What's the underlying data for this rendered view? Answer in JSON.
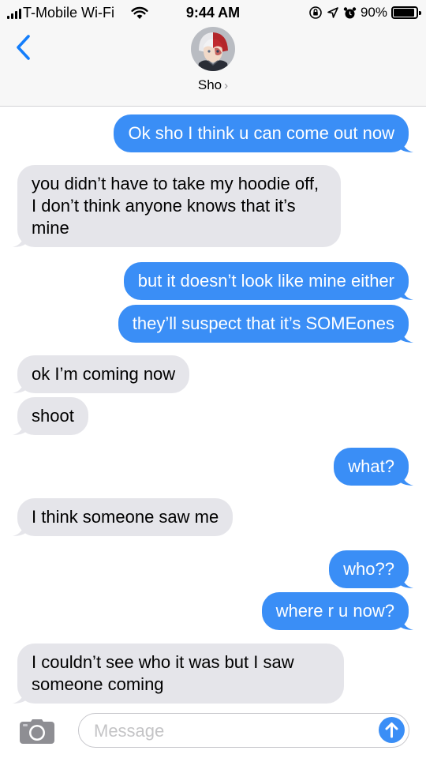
{
  "status_bar": {
    "carrier": "T-Mobile Wi-Fi",
    "time": "9:44 AM",
    "battery": "90%",
    "battery_level": 0.9,
    "icons": [
      "signal-bars-icon",
      "wifi-icon",
      "screen-lock-icon",
      "location-arrow-icon",
      "alarm-icon",
      "battery-icon"
    ]
  },
  "header": {
    "contact_name": "Sho",
    "chevron": "›",
    "back_icon": "chevron-left-icon"
  },
  "messages": [
    {
      "side": "out",
      "text": "Ok sho I think u can come out now"
    },
    {
      "side": "in",
      "text": "you didn’t have to take my hoodie off, I don’t think anyone knows that it’s mine"
    },
    {
      "side": "out",
      "text": "but it doesn’t look like mine either"
    },
    {
      "side": "out",
      "text": "they’ll suspect that it’s SOMEones"
    },
    {
      "side": "in",
      "text": "ok I’m coming now"
    },
    {
      "side": "in",
      "text": "shoot"
    },
    {
      "side": "out",
      "text": "what?"
    },
    {
      "side": "in",
      "text": "I think someone saw me"
    },
    {
      "side": "out",
      "text": "who??"
    },
    {
      "side": "out",
      "text": "where r u now?"
    },
    {
      "side": "in",
      "text": "I couldn’t see who it was but I saw someone coming"
    }
  ],
  "input_bar": {
    "placeholder": "Message",
    "camera_icon": "camera-icon",
    "send_icon": "send-arrow-up-icon"
  },
  "colors": {
    "outgoing": "#3a8ef6",
    "incoming": "#e5e5ea",
    "accent": "#147efb"
  }
}
